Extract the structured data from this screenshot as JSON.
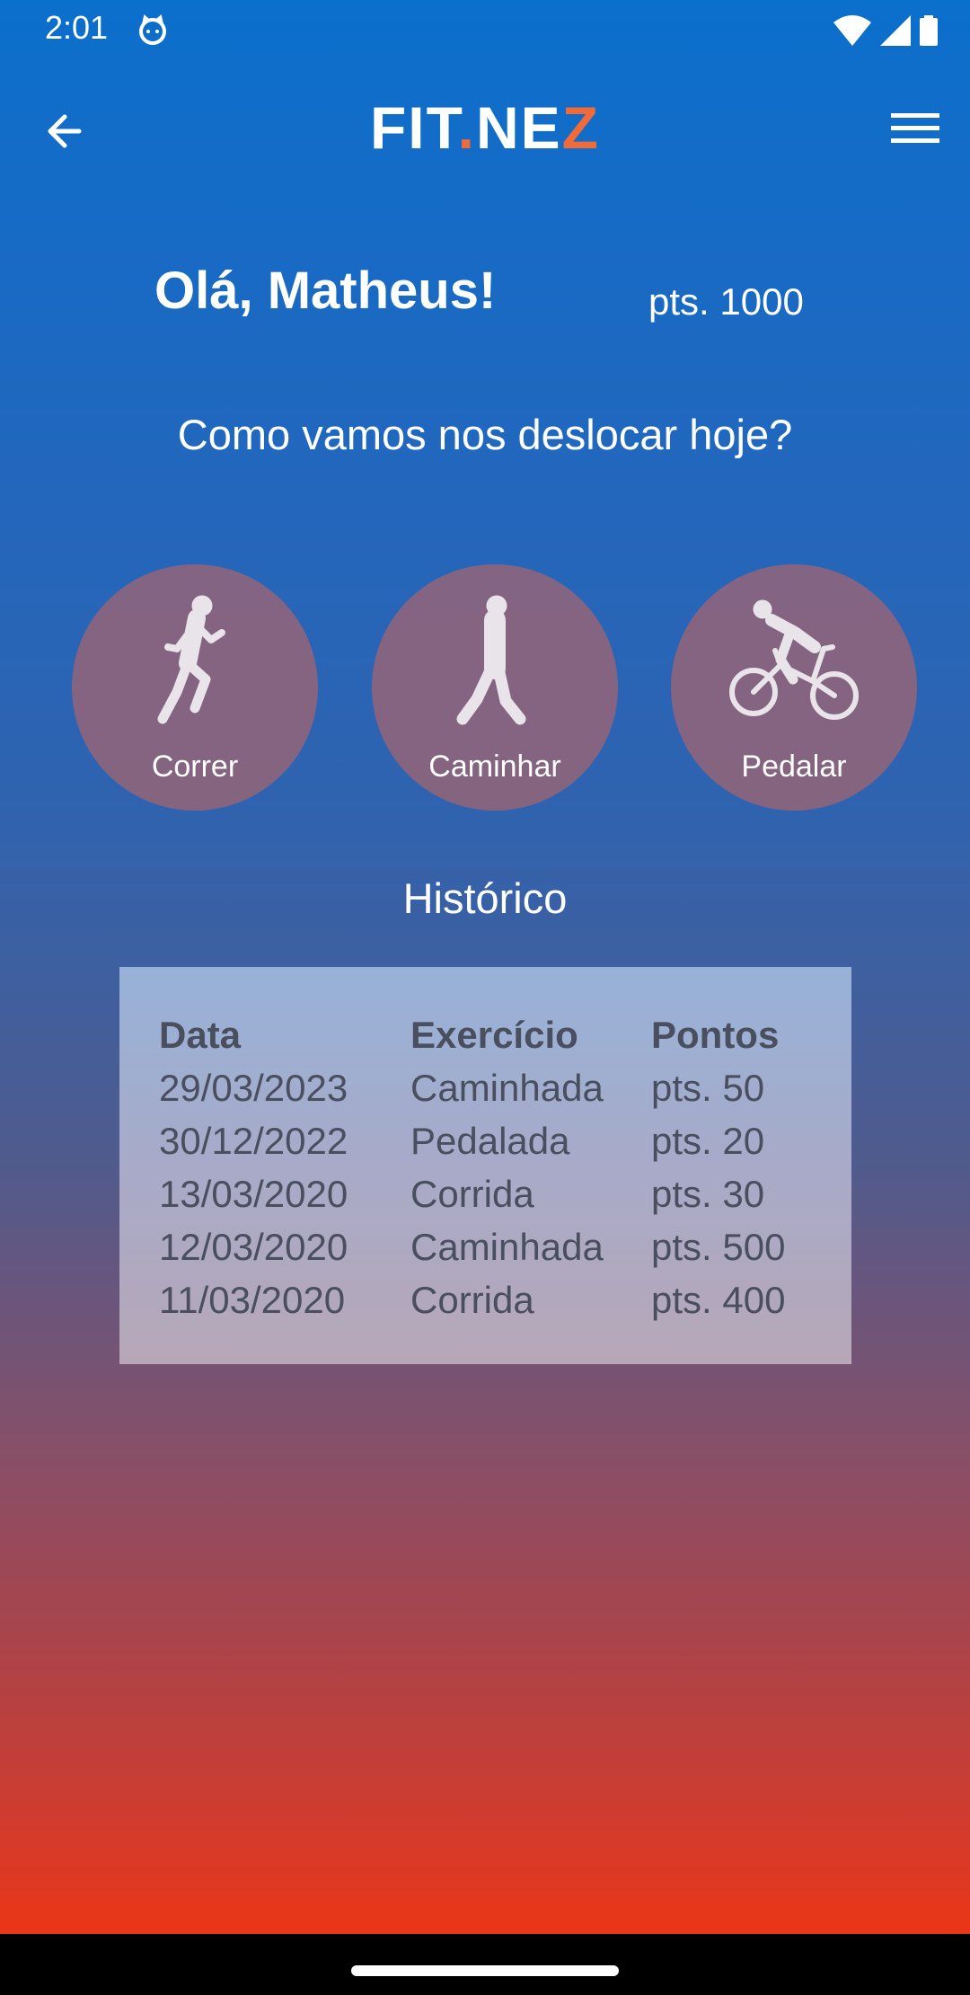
{
  "status_bar": {
    "time": "2:01"
  },
  "app_bar": {
    "logo_part1": "FIT",
    "logo_dot": ".",
    "logo_part2": "NE",
    "logo_part3": "Z"
  },
  "greeting": "Olá, Matheus!",
  "points": "pts. 1000",
  "question": "Como vamos nos deslocar hoje?",
  "modes": [
    {
      "label": "Correr",
      "icon": "runner-icon"
    },
    {
      "label": "Caminhar",
      "icon": "walker-icon"
    },
    {
      "label": "Pedalar",
      "icon": "cyclist-icon"
    }
  ],
  "history": {
    "title": "Histórico",
    "headers": [
      "Data",
      "Exercício",
      "Pontos"
    ],
    "rows": [
      [
        "29/03/2023",
        "Caminhada",
        "pts. 50"
      ],
      [
        "30/12/2022",
        "Pedalada",
        "pts. 20"
      ],
      [
        "13/03/2020",
        "Corrida",
        "pts. 30"
      ],
      [
        "12/03/2020",
        "Caminhada",
        "pts. 500"
      ],
      [
        "11/03/2020",
        "Corrida",
        "pts. 400"
      ]
    ]
  },
  "colors": {
    "accent": "#f06a3a",
    "top": "#0b6fcc",
    "bottom": "#fb3209"
  }
}
